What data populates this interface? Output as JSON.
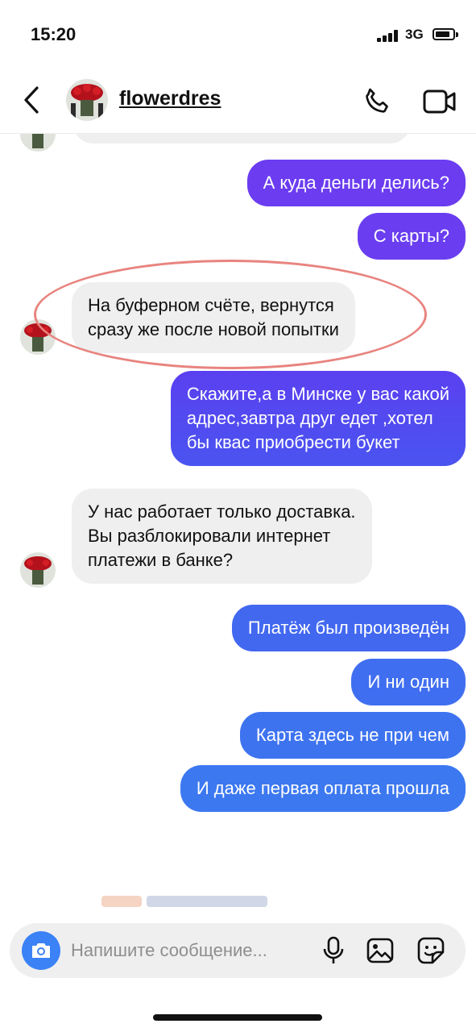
{
  "status_bar": {
    "time": "15:20",
    "network": "3G"
  },
  "header": {
    "username": "flowerdres"
  },
  "messages": [
    {
      "id": "m1",
      "side": "out",
      "text": "А куда деньги делись?"
    },
    {
      "id": "m2",
      "side": "out",
      "text": "С карты?"
    },
    {
      "id": "m3",
      "side": "in",
      "lines": [
        "На буферном счёте, вернутся",
        "сразу же после новой попытки"
      ],
      "highlighted": true
    },
    {
      "id": "m4",
      "side": "out",
      "lines": [
        "Скажите,а в Минске у вас какой",
        "адрес,завтра друг едет ,хотел",
        "бы квас приобрести букет"
      ]
    },
    {
      "id": "m5",
      "side": "in",
      "lines": [
        "У нас работает только доставка.",
        "Вы разблокировали интернет",
        "платежи в банке?"
      ]
    },
    {
      "id": "m6",
      "side": "out",
      "text": "Платёж был произведён"
    },
    {
      "id": "m7",
      "side": "out",
      "text": "И ни один"
    },
    {
      "id": "m8",
      "side": "out",
      "text": "Карта здесь не при чем"
    },
    {
      "id": "m9",
      "side": "out",
      "text": "И даже первая оплата прошла"
    }
  ],
  "composer": {
    "placeholder": "Напишите сообщение..."
  },
  "colors": {
    "outgoing_top": "#6b3df0",
    "outgoing_bottom": "#3c7ef0",
    "incoming": "#efefef",
    "highlight_ring": "#e8847f",
    "camera_button": "#3b82f6"
  },
  "icons": [
    "back-arrow-icon",
    "phone-icon",
    "video-camera-icon",
    "camera-icon",
    "microphone-icon",
    "gallery-icon",
    "sticker-icon"
  ]
}
